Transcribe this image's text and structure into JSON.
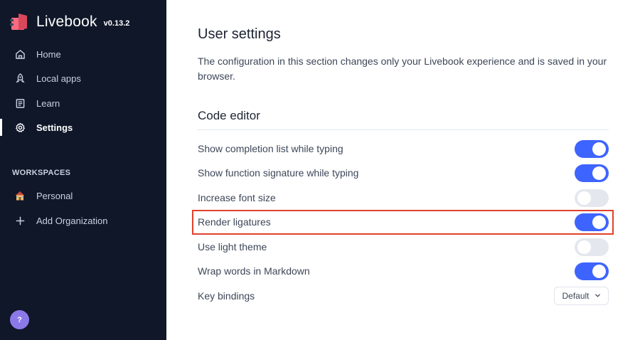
{
  "app": {
    "name": "Livebook",
    "version": "v0.13.2"
  },
  "sidebar": {
    "items": [
      {
        "label": "Home",
        "icon": "home-icon"
      },
      {
        "label": "Local apps",
        "icon": "rocket-icon"
      },
      {
        "label": "Learn",
        "icon": "book-icon"
      },
      {
        "label": "Settings",
        "icon": "gear-icon",
        "active": true
      }
    ],
    "workspaces_heading": "WORKSPACES",
    "workspaces": [
      {
        "label": "Personal",
        "icon": "house-emoji-icon"
      },
      {
        "label": "Add Organization",
        "icon": "plus-icon"
      }
    ],
    "help_label": "?"
  },
  "main": {
    "title": "User settings",
    "description": "The configuration in this section changes only your Livebook experience and is saved in your browser.",
    "section_title": "Code editor",
    "settings": [
      {
        "label": "Show completion list while typing",
        "enabled": true
      },
      {
        "label": "Show function signature while typing",
        "enabled": true
      },
      {
        "label": "Increase font size",
        "enabled": false
      },
      {
        "label": "Render ligatures",
        "enabled": true,
        "highlighted": true
      },
      {
        "label": "Use light theme",
        "enabled": false
      },
      {
        "label": "Wrap words in Markdown",
        "enabled": true
      }
    ],
    "key_bindings": {
      "label": "Key bindings",
      "value": "Default"
    }
  },
  "colors": {
    "sidebar_bg": "#0f1729",
    "toggle_on": "#3e64ff",
    "toggle_off": "#e4e8ee",
    "highlight": "#e0412c",
    "help_button": "#8c79e8"
  }
}
